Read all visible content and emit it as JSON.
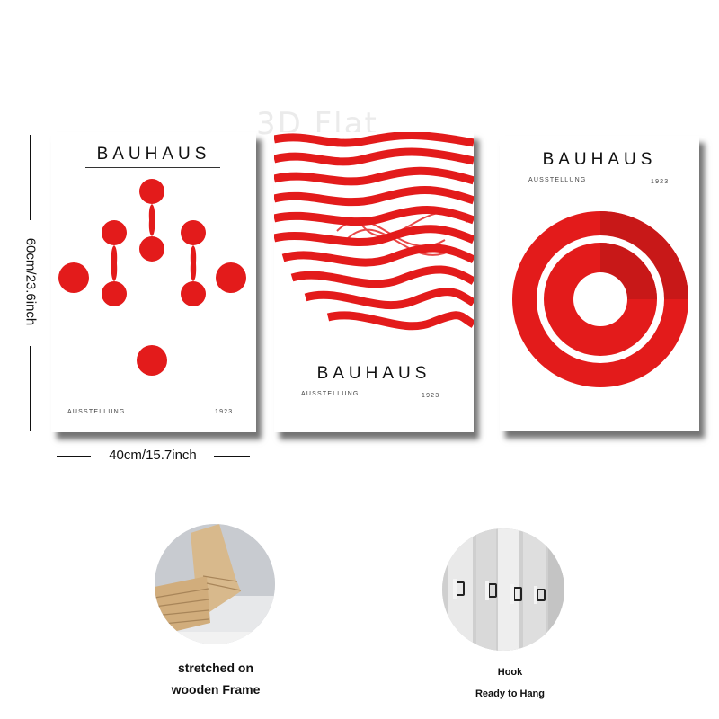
{
  "watermark": "3D Flat",
  "dimensions": {
    "height_label": "60cm/23.6inch",
    "width_label": "40cm/15.7inch"
  },
  "panels": [
    {
      "title": "BAUHAUS",
      "subtitle": "AUSSTELLUNG",
      "year": "1923",
      "motif": "red-dots-and-bars"
    },
    {
      "title": "BAUHAUS",
      "subtitle": "AUSSTELLUNG",
      "year": "1923",
      "motif": "red-wavy-stripes"
    },
    {
      "title": "BAUHAUS",
      "subtitle": "AUSSTELLUNG",
      "year": "1923",
      "motif": "red-concentric-rings"
    }
  ],
  "features": [
    {
      "caption_line1": "stretched on",
      "caption_line2": "wooden Frame"
    },
    {
      "caption_line1": "Hook",
      "caption_line2": "Ready to Hang"
    }
  ],
  "colors": {
    "accent": "#e31b1b",
    "accent_dark": "#c81818",
    "shadow": "#3a3a3a"
  }
}
